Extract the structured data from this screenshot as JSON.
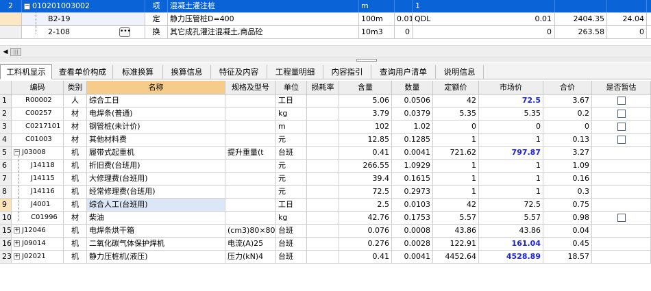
{
  "top_grid": {
    "rows": [
      {
        "no": "2",
        "code": "010201003002",
        "type": "项",
        "name": "混凝土灌注桩",
        "unit": "m",
        "qty": "",
        "qdl": "1",
        "price": "",
        "total": ""
      },
      {
        "no": "",
        "code": "B2-19",
        "type": "定",
        "name": "静力压管桩D=400",
        "unit": "100m",
        "qty": "0.01",
        "qdl": "QDL",
        "price": "0.01",
        "price2": "2404.35",
        "total": "24.04"
      },
      {
        "no": "",
        "code": "2-108",
        "type": "换",
        "name": "其它成孔灌注混凝土,商品砼",
        "unit": "10m3",
        "qty": "0",
        "qdl": "",
        "price": "0",
        "price2": "263.58",
        "total": "0"
      }
    ]
  },
  "tabs": [
    {
      "label": "工料机显示"
    },
    {
      "label": "查看单价构成"
    },
    {
      "label": "标准换算"
    },
    {
      "label": "换算信息"
    },
    {
      "label": "特征及内容"
    },
    {
      "label": "工程量明细"
    },
    {
      "label": "内容指引"
    },
    {
      "label": "查询用户清单"
    },
    {
      "label": "说明信息"
    }
  ],
  "bottom_grid": {
    "headers": [
      "",
      "编码",
      "类别",
      "名称",
      "规格及型号",
      "单位",
      "损耗率",
      "含量",
      "数量",
      "定额价",
      "市场价",
      "合价",
      "是否暂估"
    ],
    "rows": [
      {
        "no": "1",
        "code": "R00002",
        "cat": "人",
        "name": "综合工日",
        "spec": "",
        "unit": "工日",
        "loss": "",
        "content": "5.06",
        "amount": "0.0506",
        "quota": "42",
        "market": "72.5",
        "total": "3.67",
        "estimate": false,
        "market_hl": true
      },
      {
        "no": "2",
        "code": "C00257",
        "cat": "材",
        "name": "电焊条(普通)",
        "spec": "",
        "unit": "kg",
        "loss": "",
        "content": "3.79",
        "amount": "0.0379",
        "quota": "5.35",
        "market": "5.35",
        "total": "0.2",
        "estimate": true
      },
      {
        "no": "3",
        "code": "C0217101",
        "cat": "材",
        "name": "钢管桩(未计价)",
        "spec": "",
        "unit": "m",
        "loss": "",
        "content": "102",
        "amount": "1.02",
        "quota": "0",
        "market": "0",
        "total": "0",
        "estimate": true
      },
      {
        "no": "4",
        "code": "C01003",
        "cat": "材",
        "name": "其他材料费",
        "spec": "",
        "unit": "元",
        "loss": "",
        "content": "12.85",
        "amount": "0.1285",
        "quota": "1",
        "market": "1",
        "total": "0.13",
        "estimate": true
      },
      {
        "no": "5",
        "code": "J03008",
        "cat": "机",
        "name": "履带式起重机",
        "spec": "提升重量(t",
        "unit": "台班",
        "loss": "",
        "content": "0.41",
        "amount": "0.0041",
        "quota": "721.62",
        "market": "797.87",
        "total": "3.27",
        "market_hl": true,
        "expander": "−"
      },
      {
        "no": "6",
        "code": "J14118",
        "cat": "机",
        "name": "折旧费(台班用)",
        "spec": "",
        "unit": "元",
        "loss": "",
        "content": "266.55",
        "amount": "1.0929",
        "quota": "1",
        "market": "1",
        "total": "1.09",
        "child": true
      },
      {
        "no": "7",
        "code": "J14115",
        "cat": "机",
        "name": "大修理费(台班用)",
        "spec": "",
        "unit": "元",
        "loss": "",
        "content": "39.4",
        "amount": "0.1615",
        "quota": "1",
        "market": "1",
        "total": "0.16",
        "child": true
      },
      {
        "no": "8",
        "code": "J14116",
        "cat": "机",
        "name": "经常修理费(台班用)",
        "spec": "",
        "unit": "元",
        "loss": "",
        "content": "72.5",
        "amount": "0.2973",
        "quota": "1",
        "market": "1",
        "total": "0.3",
        "child": true
      },
      {
        "no": "9",
        "code": "J4001",
        "cat": "机",
        "name": "综合人工(台班用)",
        "spec": "",
        "unit": "工日",
        "loss": "",
        "content": "2.5",
        "amount": "0.0103",
        "quota": "42",
        "market": "72.5",
        "total": "0.75",
        "child": true,
        "current": true
      },
      {
        "no": "10",
        "code": "C01996",
        "cat": "材",
        "name": "柴油",
        "spec": "",
        "unit": "kg",
        "loss": "",
        "content": "42.76",
        "amount": "0.1753",
        "quota": "5.57",
        "market": "5.57",
        "total": "0.98",
        "child": true,
        "estimate": true
      },
      {
        "no": "15",
        "code": "J12046",
        "cat": "机",
        "name": "电焊条烘干箱",
        "spec": "(cm3)80×80",
        "unit": "台班",
        "loss": "",
        "content": "0.076",
        "amount": "0.0008",
        "quota": "43.86",
        "market": "43.86",
        "total": "0.04",
        "expander": "+"
      },
      {
        "no": "16",
        "code": "J09014",
        "cat": "机",
        "name": "二氧化碳气体保护焊机",
        "spec": "电流(A)25",
        "unit": "台班",
        "loss": "",
        "content": "0.276",
        "amount": "0.0028",
        "quota": "122.91",
        "market": "161.04",
        "total": "0.45",
        "market_hl": true,
        "expander": "+"
      },
      {
        "no": "23",
        "code": "J02021",
        "cat": "机",
        "name": "静力压桩机(液压)",
        "spec": "压力(kN)4",
        "unit": "台班",
        "loss": "",
        "content": "0.41",
        "amount": "0.0041",
        "quota": "4452.64",
        "market": "4528.89",
        "total": "18.57",
        "market_hl": true,
        "expander": "+"
      }
    ]
  }
}
